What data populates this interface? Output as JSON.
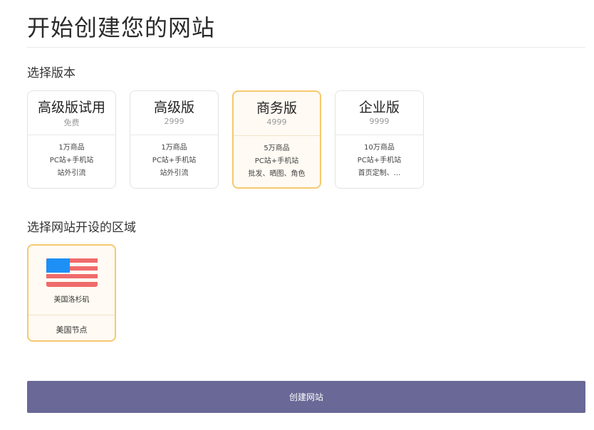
{
  "page": {
    "title": "开始创建您的网站"
  },
  "plans_section": {
    "title": "选择版本"
  },
  "plans": [
    {
      "name": "高级版试用",
      "price": "免费",
      "features": [
        "1万商品",
        "PC站+手机站",
        "站外引流"
      ],
      "selected": false
    },
    {
      "name": "高级版",
      "price": "2999",
      "features": [
        "1万商品",
        "PC站+手机站",
        "站外引流"
      ],
      "selected": false
    },
    {
      "name": "商务版",
      "price": "4999",
      "features": [
        "5万商品",
        "PC站+手机站",
        "批发、晒图、角色"
      ],
      "selected": true
    },
    {
      "name": "企业版",
      "price": "9999",
      "features": [
        "10万商品",
        "PC站+手机站",
        "首页定制、..."
      ],
      "selected": false
    }
  ],
  "region_section": {
    "title": "选择网站开设的区域"
  },
  "regions": [
    {
      "city": "美国洛杉矶",
      "node": "美国节点",
      "icon": "us-flag-icon",
      "selected": true
    }
  ],
  "actions": {
    "create_label": "创建网站"
  },
  "colors": {
    "accent": "#696896",
    "selected_border": "#f5c96e",
    "selected_bg": "#fffaf3",
    "flag_blue": "#1e90f5",
    "flag_red": "#ef6b6b"
  }
}
